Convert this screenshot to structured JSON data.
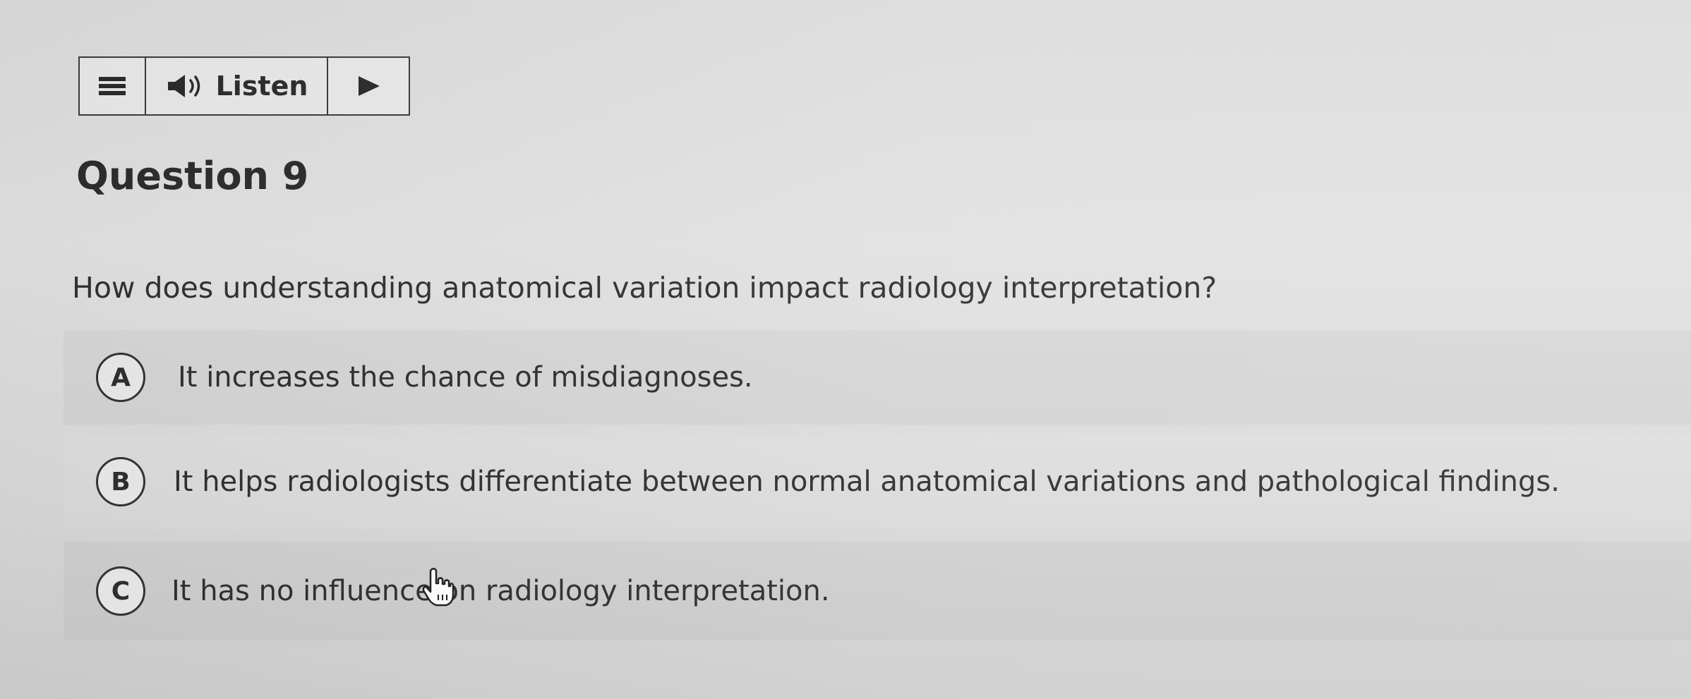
{
  "toolbar": {
    "menu_icon": "hamburger-menu-icon",
    "speaker_icon": "speaker-icon",
    "listen_label": "Listen",
    "play_icon": "play-icon"
  },
  "question": {
    "title": "Question 9",
    "text": "How does understanding anatomical variation impact radiology interpretation?"
  },
  "options": [
    {
      "letter": "A",
      "text": "It increases the chance of misdiagnoses."
    },
    {
      "letter": "B",
      "text": "It helps radiologists differentiate between normal anatomical variations and pathological findings."
    },
    {
      "letter": "C",
      "text": "It has no influence on radiology interpretation."
    }
  ],
  "cursor_icon": "hand-pointer-icon"
}
